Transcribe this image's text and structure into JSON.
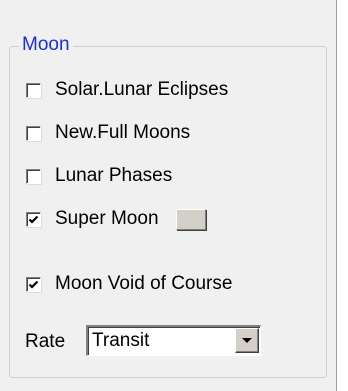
{
  "group": {
    "title": "Moon"
  },
  "options": [
    {
      "label": "Solar.Lunar Eclipses",
      "checked": false
    },
    {
      "label": "New.Full Moons",
      "checked": false
    },
    {
      "label": "Lunar Phases",
      "checked": false
    },
    {
      "label": "Super Moon",
      "checked": true
    },
    {
      "label": "Moon Void of Course",
      "checked": true
    }
  ],
  "super_moon_color": "#d4d0c8",
  "rate": {
    "label": "Rate",
    "selected": "Transit"
  },
  "colors": {
    "group_title": "#1a2ee0",
    "background": "#f0f0f0"
  }
}
